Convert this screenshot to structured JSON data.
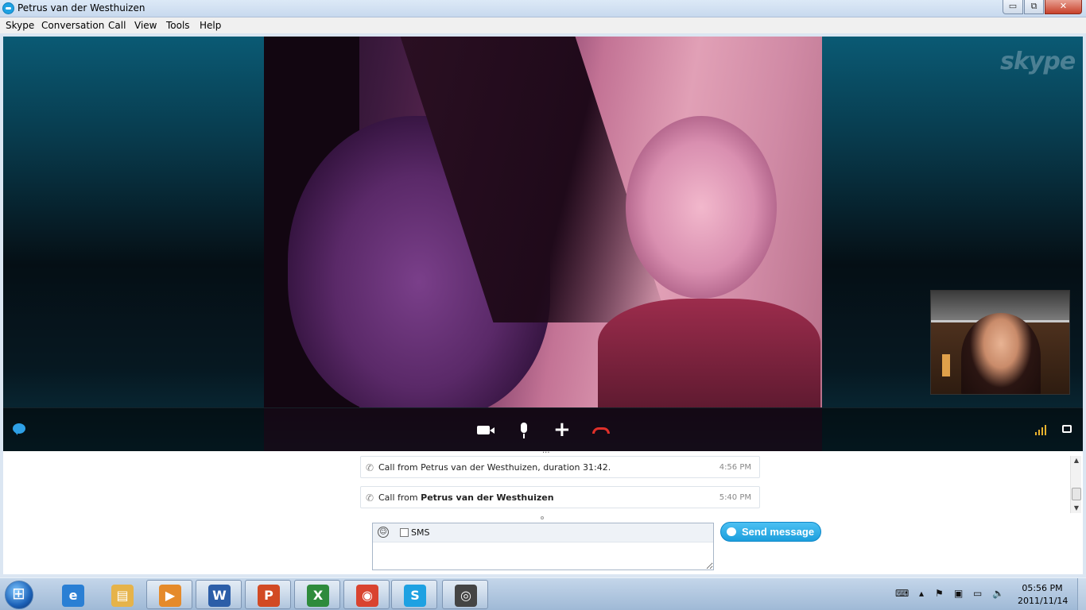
{
  "window": {
    "title": "Petrus van der Westhuizen",
    "controls": {
      "minimize": "▭",
      "maximize": "⧉",
      "close": "✕"
    }
  },
  "menu": [
    "Skype",
    "Conversation",
    "Call",
    "View",
    "Tools",
    "Help"
  ],
  "video": {
    "logo": "skype",
    "controls": [
      "chat-icon",
      "video-camera-icon",
      "microphone-icon",
      "add-icon",
      "hang-up-icon",
      "signal-strength-icon",
      "fullscreen-icon"
    ]
  },
  "history": [
    {
      "prefix": "Call from Petrus van der Westhuizen, duration 31:42.",
      "name": "",
      "time": "4:56 PM"
    },
    {
      "prefix": "Call from ",
      "name": "Petrus van der Westhuizen",
      "time": "5:40 PM"
    }
  ],
  "composer": {
    "sms_label": "SMS",
    "send_label": "Send message",
    "emoticon": "☺"
  },
  "taskbar": {
    "apps": [
      {
        "name": "internet-explorer",
        "glyph": "e",
        "color": "#2a7fd4",
        "running": false
      },
      {
        "name": "windows-explorer",
        "glyph": "▤",
        "color": "#e6b34a",
        "running": false
      },
      {
        "name": "media-player",
        "glyph": "▶",
        "color": "#e58a2a",
        "running": true
      },
      {
        "name": "word",
        "glyph": "W",
        "color": "#2c5ea8",
        "running": true
      },
      {
        "name": "powerpoint",
        "glyph": "P",
        "color": "#d24a24",
        "running": true
      },
      {
        "name": "excel",
        "glyph": "X",
        "color": "#2e8b3c",
        "running": true
      },
      {
        "name": "chrome",
        "glyph": "◉",
        "color": "#d9432f",
        "running": true
      },
      {
        "name": "skype",
        "glyph": "S",
        "color": "#1ea1e2",
        "running": true
      },
      {
        "name": "camera",
        "glyph": "◎",
        "color": "#444444",
        "running": true
      }
    ],
    "clock_time": "05:56 PM",
    "clock_date": "2011/11/14"
  }
}
